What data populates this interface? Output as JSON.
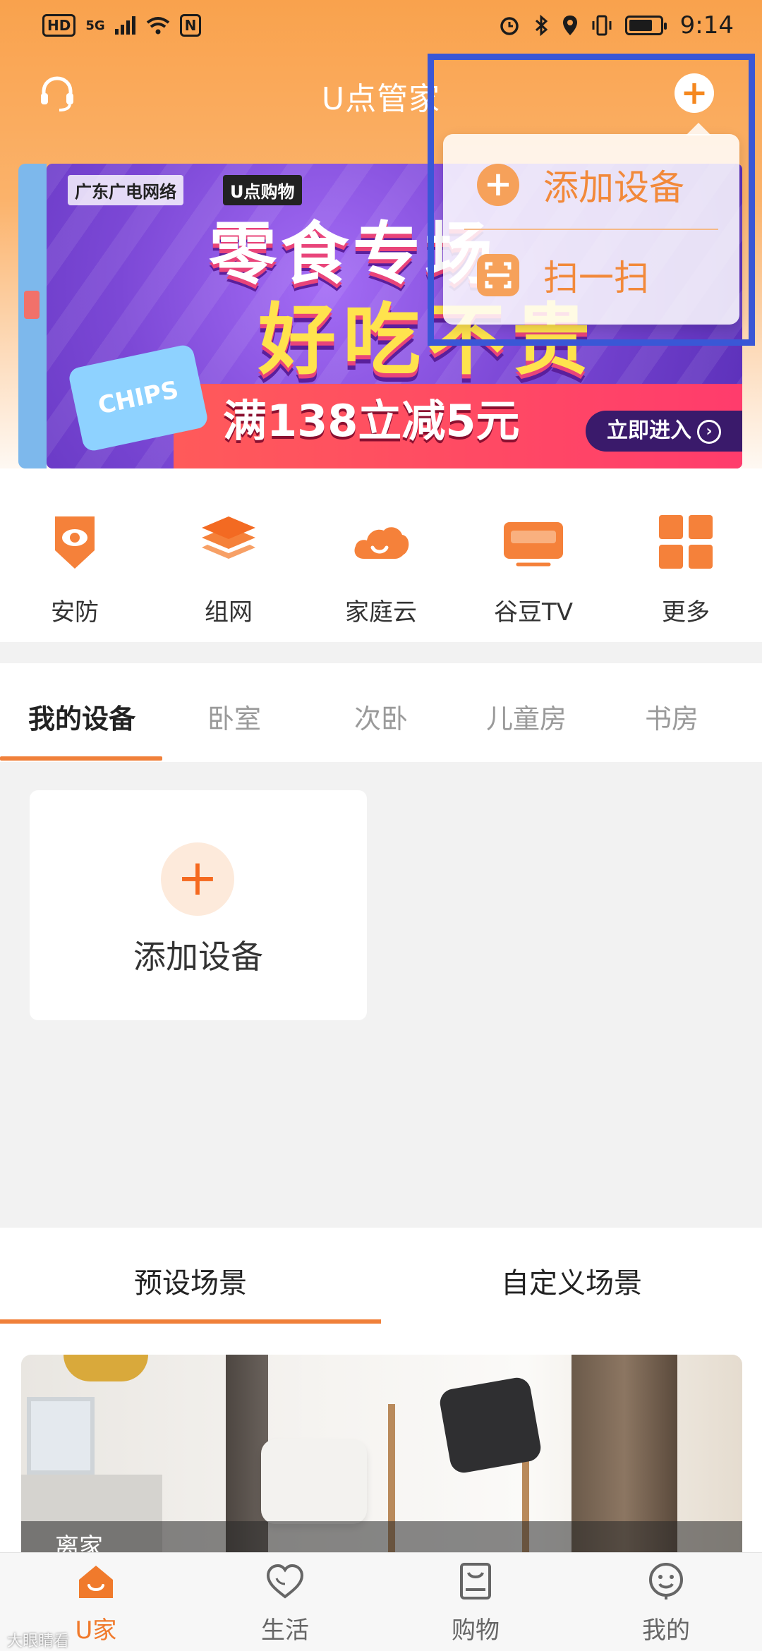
{
  "status_bar": {
    "left_items": [
      "HD",
      "5G",
      "N"
    ],
    "time": "9:14"
  },
  "header": {
    "title": "U点管家",
    "icons": [
      "headset-icon",
      "plus-icon"
    ]
  },
  "banner": {
    "brand_primary": "广东广电网络",
    "brand_secondary": "U点购物",
    "headline_line1": "零食专场",
    "headline_line2": "好吃不贵",
    "promo_text": "满138立减5元",
    "chips_label": "CHIPS",
    "enter_button": "立即进入"
  },
  "add_menu": {
    "items": [
      {
        "label": "添加设备",
        "icon": "plus-circle-icon"
      },
      {
        "label": "扫一扫",
        "icon": "scan-icon"
      }
    ]
  },
  "quick_menu": {
    "items": [
      {
        "label": "安防",
        "icon": "security-shield-icon"
      },
      {
        "label": "组网",
        "icon": "network-layers-icon"
      },
      {
        "label": "家庭云",
        "icon": "cloud-icon"
      },
      {
        "label": "谷豆TV",
        "icon": "tv-icon"
      },
      {
        "label": "更多",
        "icon": "grid-more-icon"
      }
    ]
  },
  "room_tabs": {
    "items": [
      "我的设备",
      "卧室",
      "次卧",
      "儿童房",
      "书房"
    ],
    "active": "我的设备"
  },
  "devices": {
    "add_card_label": "添加设备"
  },
  "scene_tabs": {
    "items": [
      "预设场景",
      "自定义场景"
    ],
    "active": "预设场景"
  },
  "scene": {
    "caption": "离家"
  },
  "bottom_nav": {
    "items": [
      {
        "label": "U家",
        "icon": "home-icon"
      },
      {
        "label": "生活",
        "icon": "heart-icon"
      },
      {
        "label": "购物",
        "icon": "shopping-bag-icon"
      },
      {
        "label": "我的",
        "icon": "smiley-face-icon"
      }
    ],
    "active": "U家"
  },
  "watermark": "大眼睛看",
  "colors": {
    "accent": "#f5881f",
    "tab_underline": "#f0803a",
    "highlight_box": "#3a57d6"
  }
}
